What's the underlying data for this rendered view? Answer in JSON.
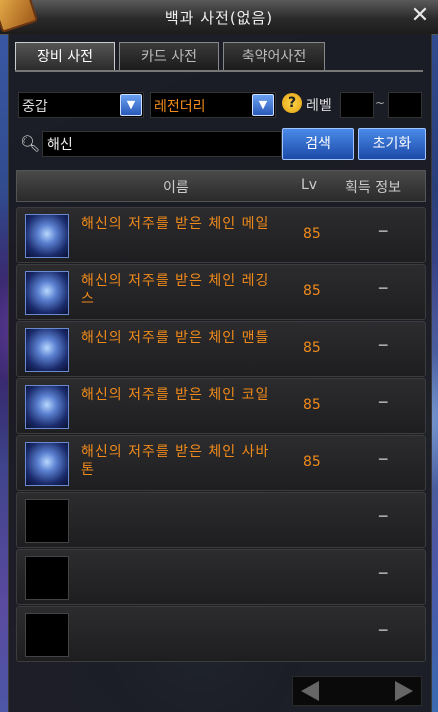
{
  "window": {
    "title": "백과 사전(없음)",
    "close_label": "✕"
  },
  "tabs": [
    {
      "label": "장비 사전",
      "active": true
    },
    {
      "label": "카드 사전",
      "active": false
    },
    {
      "label": "축약어사전",
      "active": false
    }
  ],
  "filters": {
    "category": "중갑",
    "rarity": "레전더리",
    "level_label": "레벨",
    "level_min": "",
    "level_max": "",
    "range_sep": "~"
  },
  "search": {
    "value": "해신",
    "button_label": "검색",
    "reset_label": "초기화"
  },
  "table": {
    "columns": [
      "이름",
      "Lv",
      "획득 정보"
    ],
    "rows": [
      {
        "name": "해신의 저주를 받은 체인 메일",
        "lv": "85",
        "info": "─"
      },
      {
        "name": "해신의 저주를 받은 체인 레깅스",
        "lv": "85",
        "info": "─"
      },
      {
        "name": "해신의 저주를 받은 체인 맨틀",
        "lv": "85",
        "info": "─"
      },
      {
        "name": "해신의 저주를 받은 체인 코일",
        "lv": "85",
        "info": "─"
      },
      {
        "name": "해신의 저주를 받은 체인 사바톤",
        "lv": "85",
        "info": "─"
      },
      {
        "name": "",
        "lv": "",
        "info": "─"
      },
      {
        "name": "",
        "lv": "",
        "info": "─"
      },
      {
        "name": "",
        "lv": "",
        "info": "─"
      }
    ]
  },
  "colors": {
    "item_name": "#f08a1a",
    "button": "#2c64c8"
  }
}
